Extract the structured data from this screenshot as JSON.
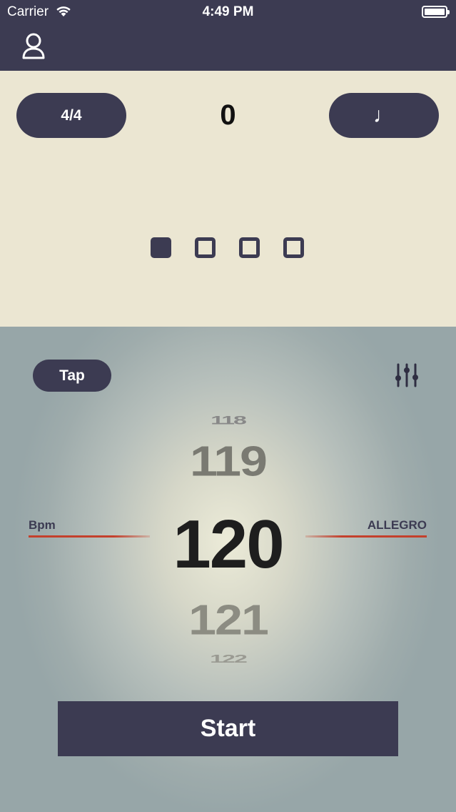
{
  "status_bar": {
    "carrier": "Carrier",
    "time": "4:49 PM"
  },
  "nav": {
    "profile_icon": "person-icon"
  },
  "meter": {
    "time_signature": "4/4",
    "beat_count": "0",
    "note_value": "♩",
    "beats_total": 4,
    "active_beat": 1
  },
  "tempo": {
    "tap_label": "Tap",
    "settings_icon": "sliders-icon",
    "bpm_label": "Bpm",
    "tempo_name": "ALLEGRO",
    "values": {
      "minus2": "118",
      "minus1": "119",
      "current": "120",
      "plus1": "121",
      "plus2": "122"
    }
  },
  "start_label": "Start",
  "colors": {
    "primary": "#3c3b52",
    "beige": "#ebe6d2",
    "accent_line": "#c4402c"
  }
}
